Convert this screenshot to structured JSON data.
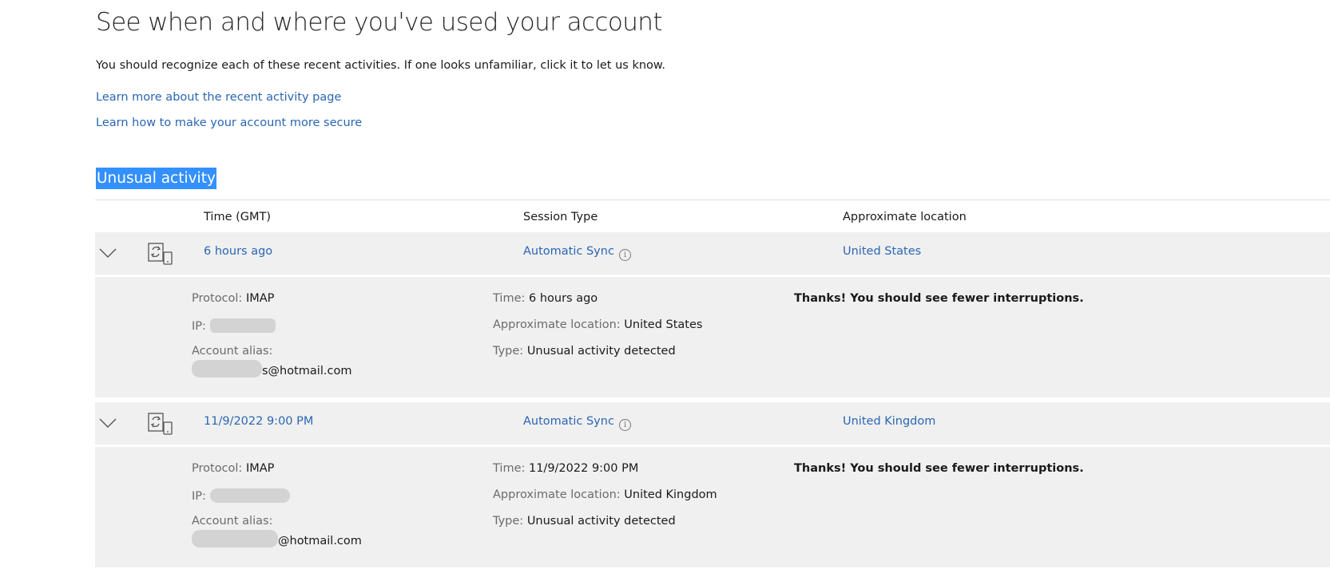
{
  "page": {
    "title": "See when and where you've used your account",
    "intro": "You should recognize each of these recent activities. If one looks unfamiliar, click it to let us know.",
    "links": [
      "Learn more about the recent activity page",
      "Learn how to make your account more secure"
    ]
  },
  "section": {
    "heading": "Unusual activity",
    "columns": [
      "Time (GMT)",
      "Session Type",
      "Approximate location"
    ]
  },
  "labels": {
    "protocol": "Protocol:",
    "ip": "IP:",
    "account_alias": "Account alias:",
    "time": "Time:",
    "approximate_location": "Approximate location:",
    "type": "Type:"
  },
  "activities": [
    {
      "time": "6 hours ago",
      "session_type": "Automatic Sync",
      "location": "United States",
      "protocol": "IMAP",
      "alias_suffix": "s@hotmail.com",
      "type": "Unusual activity detected",
      "confirmation": "Thanks! You should see fewer interruptions."
    },
    {
      "time": "11/9/2022 9:00 PM",
      "session_type": "Automatic Sync",
      "location": "United Kingdom",
      "protocol": "IMAP",
      "alias_suffix": "@hotmail.com",
      "type": "Unusual activity detected",
      "confirmation": "Thanks! You should see fewer interruptions."
    }
  ],
  "icons": {
    "chevron": "chevron-down-icon",
    "device": "sync-device-icon",
    "info": "info-icon"
  },
  "colors": {
    "link": "#2a66b3",
    "selection": "#3390ff",
    "row_background": "#f0f0f0"
  }
}
